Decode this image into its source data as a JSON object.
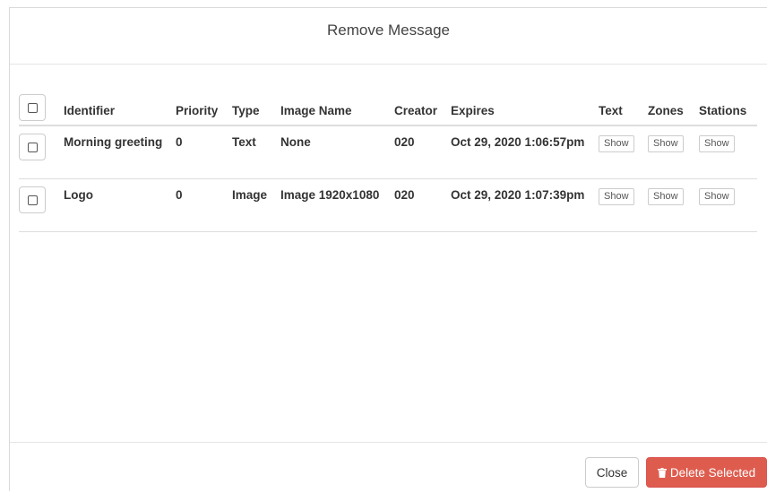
{
  "dialog": {
    "title": "Remove Message"
  },
  "table": {
    "headers": {
      "identifier": "Identifier",
      "priority": "Priority",
      "type": "Type",
      "image_name": "Image Name",
      "creator": "Creator",
      "expires": "Expires",
      "text": "Text",
      "zones": "Zones",
      "stations": "Stations"
    },
    "rows": [
      {
        "identifier": "Morning greeting",
        "priority": "0",
        "type": "Text",
        "image_name": "None",
        "creator": "020",
        "expires": "Oct 29, 2020 1:06:57pm",
        "text_btn": "Show",
        "zones_btn": "Show",
        "stations_btn": "Show"
      },
      {
        "identifier": "Logo",
        "priority": "0",
        "type": "Image",
        "image_name": "Image 1920x1080",
        "creator": "020",
        "expires": "Oct 29, 2020 1:07:39pm",
        "text_btn": "Show",
        "zones_btn": "Show",
        "stations_btn": "Show"
      }
    ]
  },
  "footer": {
    "close_label": "Close",
    "delete_label": "Delete Selected",
    "delete_icon": "trash-icon"
  },
  "colors": {
    "danger": "#de5c4e"
  }
}
